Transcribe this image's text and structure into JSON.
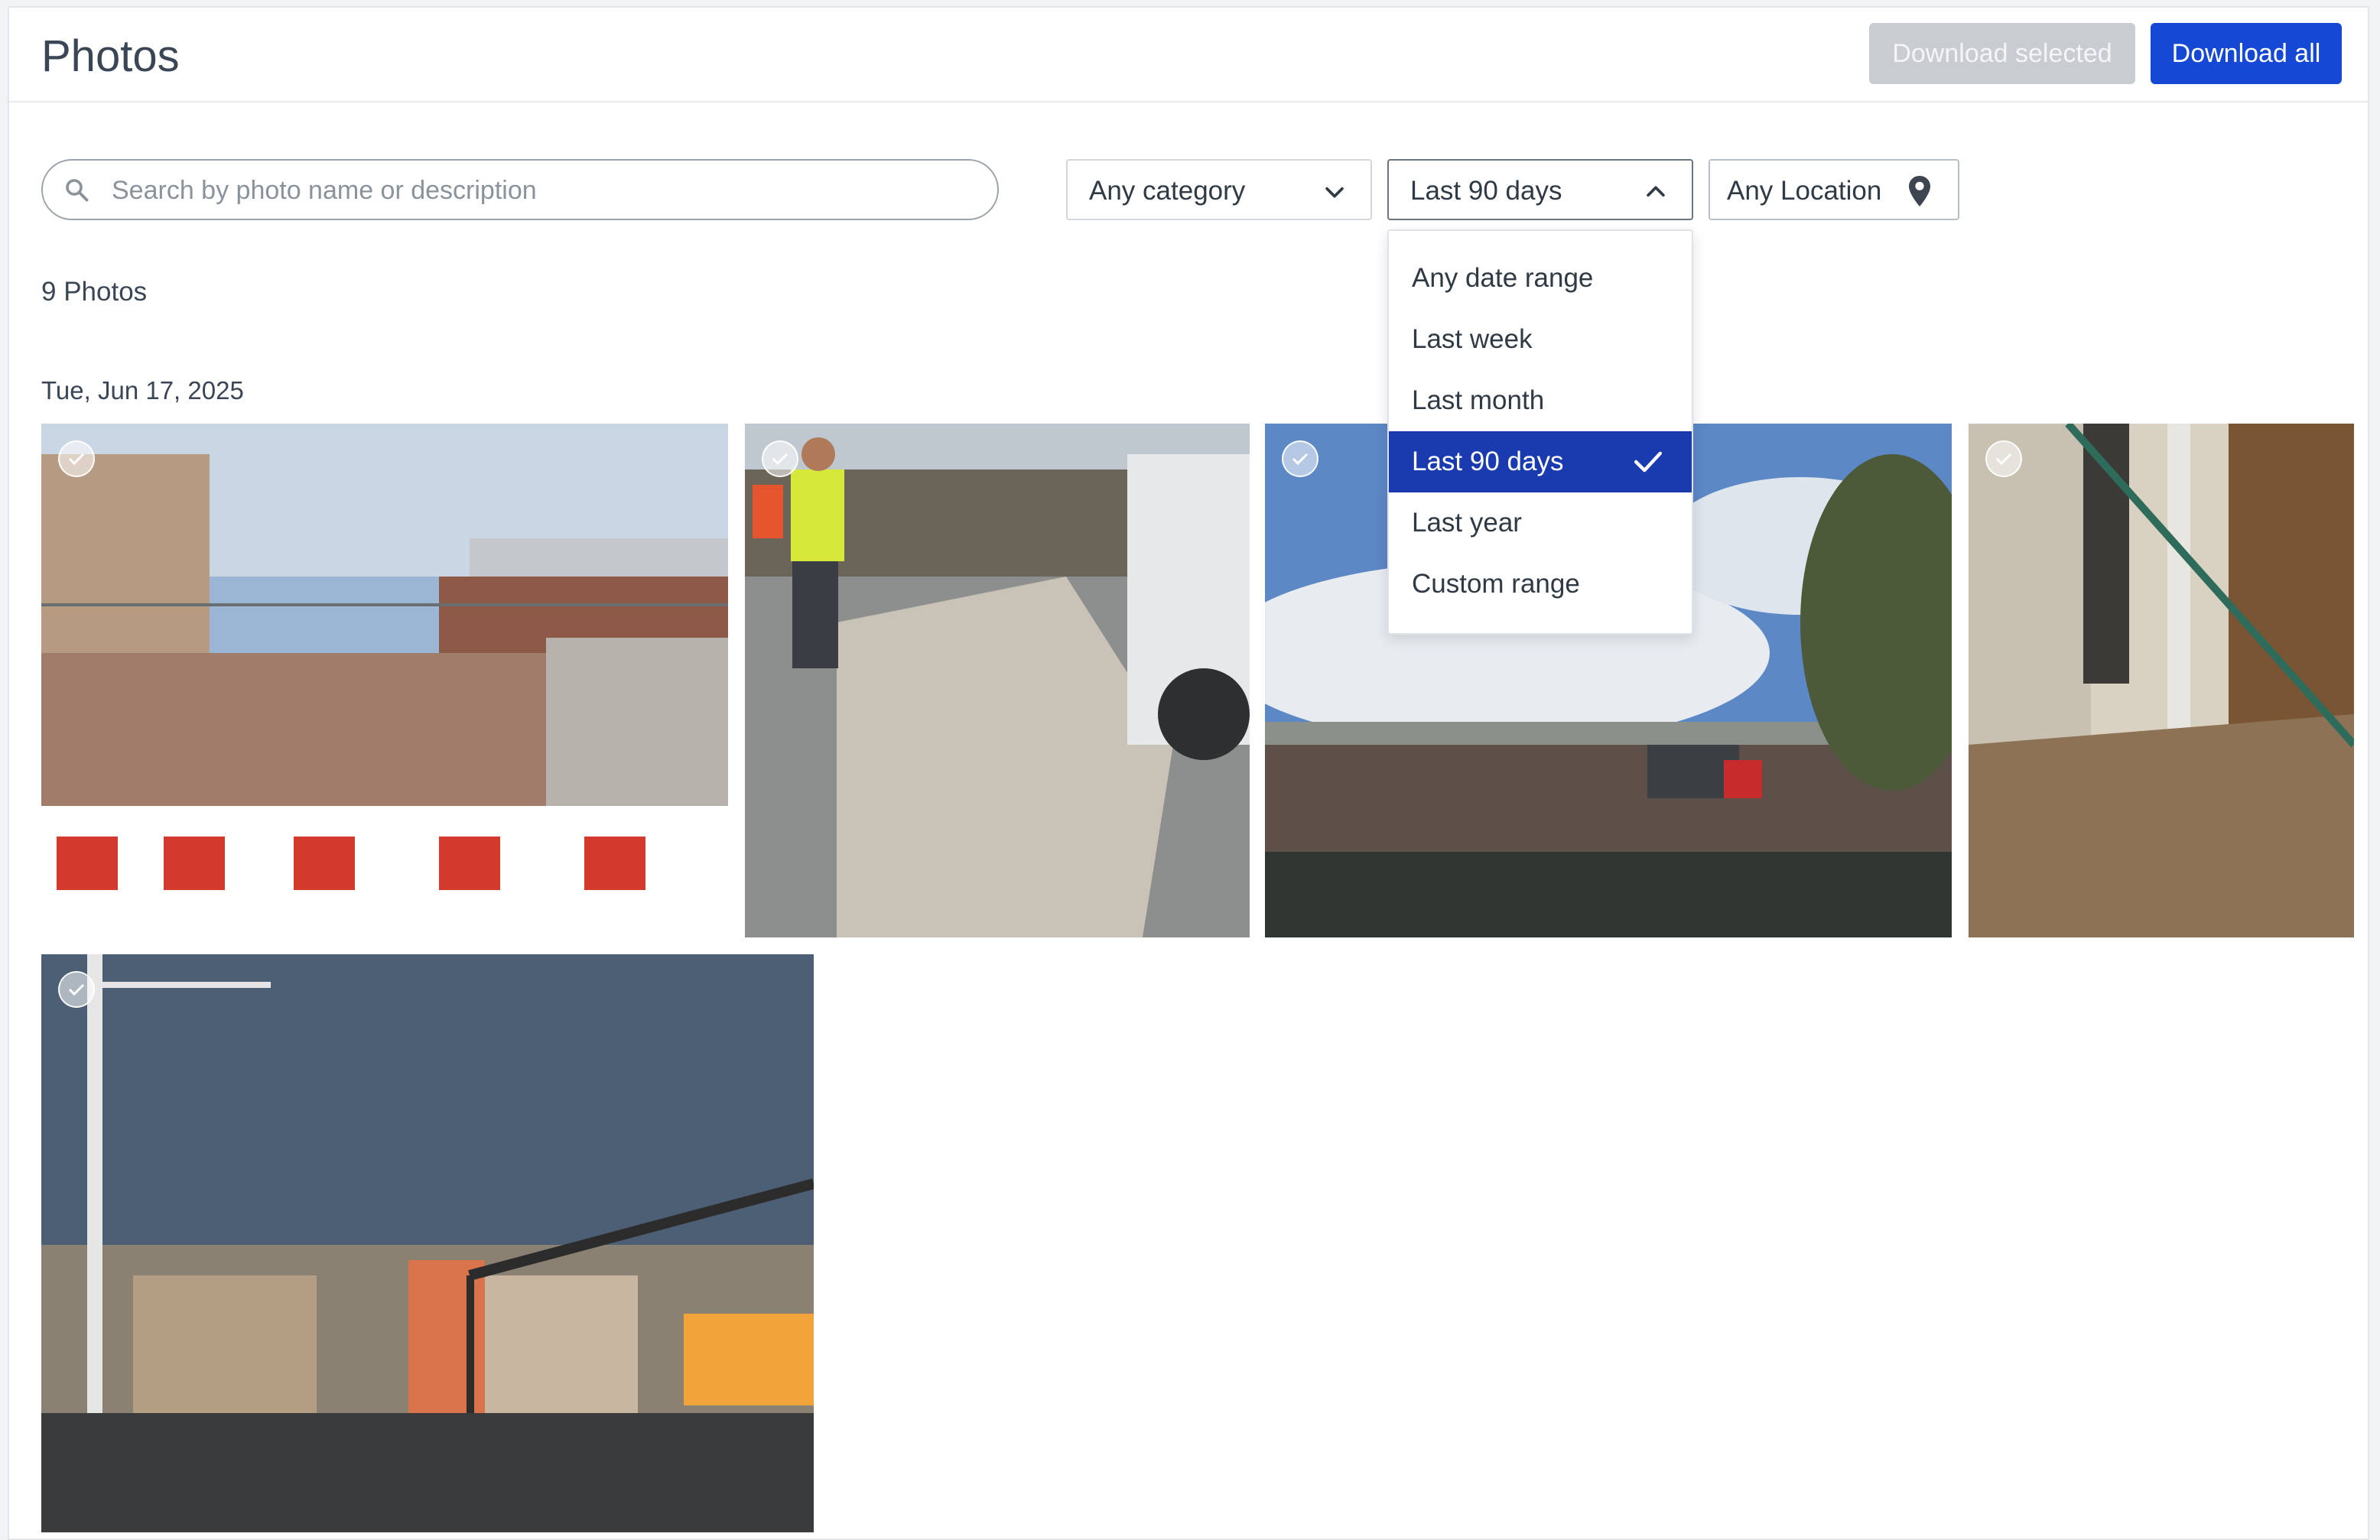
{
  "header": {
    "title": "Photos",
    "download_selected_label": "Download selected",
    "download_all_label": "Download all"
  },
  "filters": {
    "search_placeholder": "Search by photo name or description",
    "category_value": "Any category",
    "date_value": "Last 90 days",
    "location_value": "Any Location"
  },
  "date_menu": {
    "items": [
      {
        "label": "Any date range",
        "selected": false
      },
      {
        "label": "Last week",
        "selected": false
      },
      {
        "label": "Last month",
        "selected": false
      },
      {
        "label": "Last 90 days",
        "selected": true
      },
      {
        "label": "Last year",
        "selected": false
      },
      {
        "label": "Custom range",
        "selected": false
      }
    ]
  },
  "results": {
    "count_label": "9 Photos",
    "groups": [
      {
        "date_label": "Tue, Jun 17, 2025"
      }
    ]
  },
  "colors": {
    "primary": "#1648d6",
    "disabled": "#c9ccd0",
    "menu_selected": "#1a3ab0"
  },
  "icons": [
    "search-icon",
    "chevron-down-icon",
    "chevron-up-icon",
    "location-pin-icon",
    "checkmark-icon"
  ]
}
